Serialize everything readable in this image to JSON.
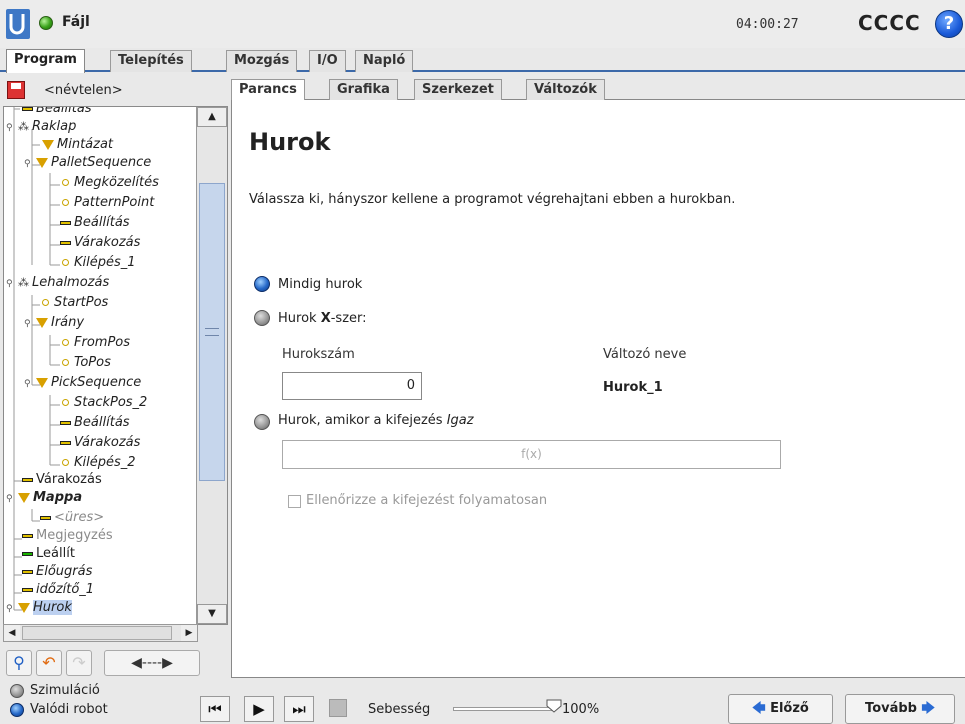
{
  "header": {
    "file_menu": "Fájl",
    "clock": "04:00:27",
    "robot_name": "CCCC",
    "help": "?"
  },
  "main_tabs": [
    "Program",
    "Telepítés",
    "Mozgás",
    "I/O",
    "Napló"
  ],
  "program_name": "<névtelen>",
  "tree": [
    {
      "label": "Beállítás",
      "icon": "bar-icon"
    },
    {
      "label": "Raklap",
      "icon": "pallet-icon"
    },
    {
      "label": "Mintázat",
      "icon": "triangle-icon"
    },
    {
      "label": "PalletSequence",
      "icon": "triangle-icon"
    },
    {
      "label": "Megközelítés",
      "icon": "point-icon"
    },
    {
      "label": "PatternPoint",
      "icon": "point-icon"
    },
    {
      "label": "Beállítás",
      "icon": "bar-icon"
    },
    {
      "label": "Várakozás",
      "icon": "bar-icon"
    },
    {
      "label": "Kilépés_1",
      "icon": "point-icon"
    },
    {
      "label": "Lehalmozás",
      "icon": "pallet-icon"
    },
    {
      "label": "StartPos",
      "icon": "point-icon"
    },
    {
      "label": "Irány",
      "icon": "triangle-icon"
    },
    {
      "label": "FromPos",
      "icon": "point-icon"
    },
    {
      "label": "ToPos",
      "icon": "point-icon"
    },
    {
      "label": "PickSequence",
      "icon": "triangle-icon"
    },
    {
      "label": "StackPos_2",
      "icon": "point-icon"
    },
    {
      "label": "Beállítás",
      "icon": "bar-icon"
    },
    {
      "label": "Várakozás",
      "icon": "bar-icon"
    },
    {
      "label": "Kilépés_2",
      "icon": "point-icon"
    },
    {
      "label": "Várakozás",
      "icon": "bar-icon"
    },
    {
      "label": "Mappa",
      "icon": "triangle-icon"
    },
    {
      "label": "<üres>",
      "icon": "bar-icon"
    },
    {
      "label": "Megjegyzés",
      "icon": "bar-icon"
    },
    {
      "label": "Leállít",
      "icon": "bar-icon"
    },
    {
      "label": "Előugrás",
      "icon": "bar-icon"
    },
    {
      "label": "időzítő_1",
      "icon": "bar-icon"
    },
    {
      "label": "Hurok",
      "icon": "triangle-icon"
    }
  ],
  "sub_tabs": [
    "Parancs",
    "Grafika",
    "Szerkezet",
    "Változók"
  ],
  "content": {
    "title": "Hurok",
    "description": "Válassza ki, hányszor kellene a programot végrehajtani ebben a hurokban.",
    "options": {
      "always": "Mindig hurok",
      "times_prefix": "Hurok ",
      "times_x": "X",
      "times_suffix": "-szer:",
      "expr_prefix": "Hurok, amikor a kifejezés ",
      "expr_italic": "Igaz"
    },
    "loop_count_label": "Hurokszám",
    "loop_count_value": "0",
    "var_name_label": "Változó neve",
    "var_name_value": "Hurok_1",
    "expr_placeholder": "f(x)",
    "check_continuous": "Ellenőrizze a kifejezést folyamatosan"
  },
  "footer": {
    "simulation": "Szimuláció",
    "real_robot": "Valódi robot",
    "speed_label": "Sebesség",
    "speed_value": "100%",
    "speed_fraction": 1.0,
    "prev": "Előző",
    "next": "Tovább"
  },
  "colors": {
    "accent": "#3c69a9",
    "selection": "#bcd0f0"
  }
}
